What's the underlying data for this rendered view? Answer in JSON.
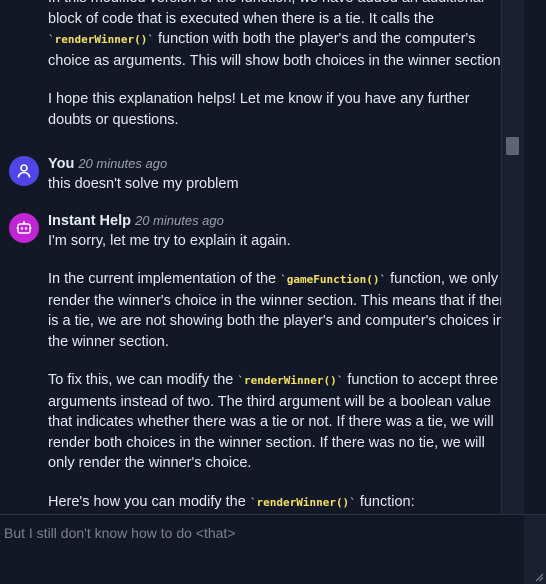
{
  "chat": {
    "messages": [
      {
        "paragraphs": [
          {
            "before": "In this modified version of the function, we have added an additional block of code that is executed when there is a tie. It calls the ",
            "code": "renderWinner()",
            "after": " function with both the player's and the computer's choice as arguments. This will show both choices in the winner section."
          },
          {
            "text": "I hope this explanation helps! Let me know if you have any further doubts or questions."
          }
        ]
      },
      {
        "author": "You",
        "time": "20 minutes ago",
        "text": "this doesn't solve my problem"
      },
      {
        "author": "Instant Help",
        "time": "20 minutes ago",
        "paragraphs": [
          {
            "text": "I'm sorry, let me try to explain it again."
          },
          {
            "before": "In the current implementation of the ",
            "code": "gameFunction()",
            "after": " function, we only render the winner's choice in the winner section. This means that if there is a tie, we are not showing both the player's and computer's choices in the winner section."
          },
          {
            "before": "To fix this, we can modify the ",
            "code": "renderWinner()",
            "after": " function to accept three arguments instead of two. The third argument will be a boolean value that indicates whether there was a tie or not. If there was a tie, we will render both choices in the winner section. If there was no tie, we will only render the winner's choice."
          },
          {
            "before": "Here's how you can modify the ",
            "code": "renderWinner()",
            "after": " function:"
          }
        ]
      }
    ]
  },
  "composer": {
    "placeholder": "But I still don't know how to do <that>"
  },
  "colors": {
    "background": "#121826",
    "code": "#f6e05e",
    "user_avatar": "#4f46e5",
    "bot_avatar": "#c026d3"
  },
  "icons": {
    "user_avatar": "person-icon",
    "bot_avatar": "robot-icon",
    "resize": "resize-grip-icon"
  }
}
